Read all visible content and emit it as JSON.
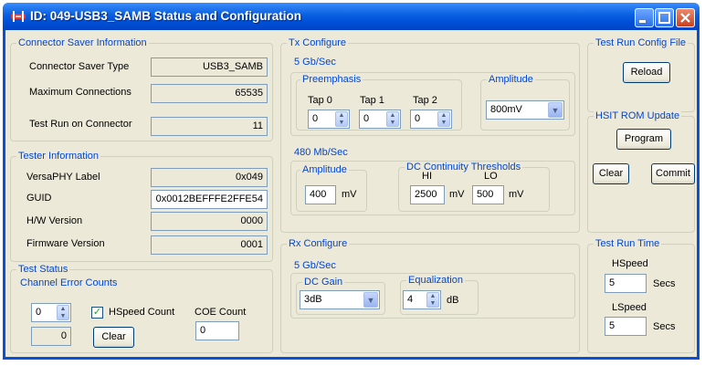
{
  "window": {
    "title": "ID: 049-USB3_SAMB Status and Configuration"
  },
  "connector_saver": {
    "group_label": "Connector Saver Information",
    "type_label": "Connector Saver Type",
    "type_value": "USB3_SAMB",
    "max_conn_label": "Maximum Connections",
    "max_conn_value": "65535",
    "test_run_label": "Test Run on Connector",
    "test_run_value": "11"
  },
  "tester": {
    "group_label": "Tester Information",
    "versaphy_label": "VersaPHY Label",
    "versaphy_value": "0x049",
    "guid_label": "GUID",
    "guid_value": "0x0012BEFFFE2FFE54",
    "hw_label": "H/W Version",
    "hw_value": "0000",
    "fw_label": "Firmware Version",
    "fw_value": "0001"
  },
  "test_status": {
    "group_label": "Test Status",
    "channel_label": "Channel Error Counts",
    "channel_value": "0",
    "error_count_value": "0",
    "hspeed_count_label": "HSpeed Count",
    "hspeed_checked": true,
    "clear_label": "Clear",
    "coe_label": "COE Count",
    "coe_value": "0"
  },
  "tx": {
    "group_label": "Tx Configure",
    "gbs_label": "5 Gb/Sec",
    "preemphasis_label": "Preemphasis",
    "tap0_label": "Tap 0",
    "tap0_value": "0",
    "tap1_label": "Tap 1",
    "tap1_value": "0",
    "tap2_label": "Tap 2",
    "tap2_value": "0",
    "amplitude_label": "Amplitude",
    "amplitude_value": "800mV",
    "mbs_label": "480 Mb/Sec",
    "mbs_amplitude_label": "Amplitude",
    "mbs_amplitude_value": "400",
    "mbs_amplitude_unit": "mV",
    "dc_label": "DC Continuity Thresholds",
    "hi_label": "HI",
    "hi_value": "2500",
    "hi_unit": "mV",
    "lo_label": "LO",
    "lo_value": "500",
    "lo_unit": "mV"
  },
  "rx": {
    "group_label": "Rx Configure",
    "gbs_label": "5 Gb/Sec",
    "dc_gain_label": "DC Gain",
    "dc_gain_value": "3dB",
    "eq_label": "Equalization",
    "eq_value": "4",
    "eq_unit": "dB"
  },
  "config_file": {
    "group_label": "Test Run Config File",
    "reload_label": "Reload"
  },
  "hsit": {
    "group_label": "HSIT ROM Update",
    "program_label": "Program",
    "clear_label": "Clear",
    "commit_label": "Commit"
  },
  "run_time": {
    "group_label": "Test Run Time",
    "hspeed_label": "HSpeed",
    "hspeed_value": "5",
    "hspeed_unit": "Secs",
    "lspeed_label": "LSpeed",
    "lspeed_value": "5",
    "lspeed_unit": "Secs"
  }
}
